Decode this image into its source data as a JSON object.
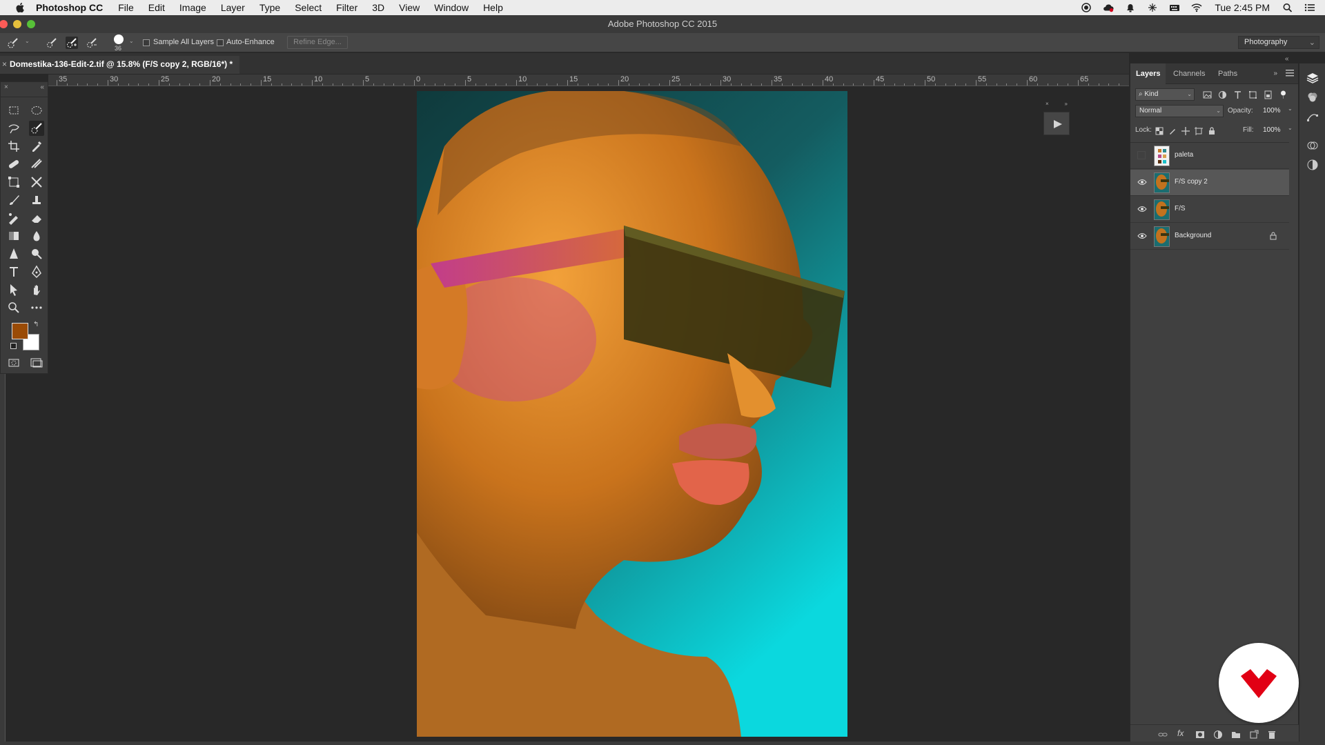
{
  "menubar": {
    "app_name": "Photoshop CC",
    "items": [
      "File",
      "Edit",
      "Image",
      "Layer",
      "Type",
      "Select",
      "Filter",
      "3D",
      "View",
      "Window",
      "Help"
    ],
    "clock": "Tue 2:45 PM",
    "status_icons": [
      "record-icon",
      "creative-cloud-icon",
      "notification-icon",
      "network-icon",
      "keyboard-icon",
      "wifi-icon"
    ]
  },
  "window": {
    "title": "Adobe Photoshop CC 2015"
  },
  "options": {
    "brush_size": "36",
    "sample_all_layers": "Sample All Layers",
    "auto_enhance": "Auto-Enhance",
    "refine_edge": "Refine Edge...",
    "workspace": "Photography"
  },
  "document": {
    "tab_title": "Domestika-136-Edit-2.tif @ 15.8% (F/S copy 2, RGB/16*) *"
  },
  "ruler": {
    "labels": [
      "35",
      "30",
      "25",
      "20",
      "15",
      "10",
      "5",
      "0",
      "5",
      "10",
      "15",
      "20",
      "25",
      "30",
      "35",
      "40",
      "45",
      "50",
      "55",
      "60",
      "65"
    ]
  },
  "colors": {
    "foreground": "#9a4b06",
    "background": "#ffffff",
    "accent": "#e10014"
  },
  "layers_panel": {
    "tabs": [
      "Layers",
      "Channels",
      "Paths"
    ],
    "filter_kind": "Kind",
    "blend_mode": "Normal",
    "opacity_label": "Opacity:",
    "opacity_value": "100%",
    "lock_label": "Lock:",
    "fill_label": "Fill:",
    "fill_value": "100%",
    "layers": [
      {
        "name": "paleta",
        "visible": false,
        "active": false,
        "locked": false
      },
      {
        "name": "F/S copy 2",
        "visible": true,
        "active": true,
        "locked": false
      },
      {
        "name": "F/S",
        "visible": true,
        "active": false,
        "locked": false
      },
      {
        "name": "Background",
        "visible": true,
        "active": false,
        "locked": true
      }
    ]
  },
  "tools": [
    "rectangular-marquee",
    "elliptical-marquee",
    "lasso",
    "quick-selection",
    "crop",
    "eyedropper",
    "healing-brush",
    "patch",
    "transform",
    "content-aware-move",
    "brush",
    "clone-stamp",
    "mixer-brush",
    "eraser",
    "gradient",
    "blur",
    "sharpen",
    "dodge",
    "type",
    "pen",
    "path-selection",
    "hand",
    "zoom",
    "more"
  ]
}
